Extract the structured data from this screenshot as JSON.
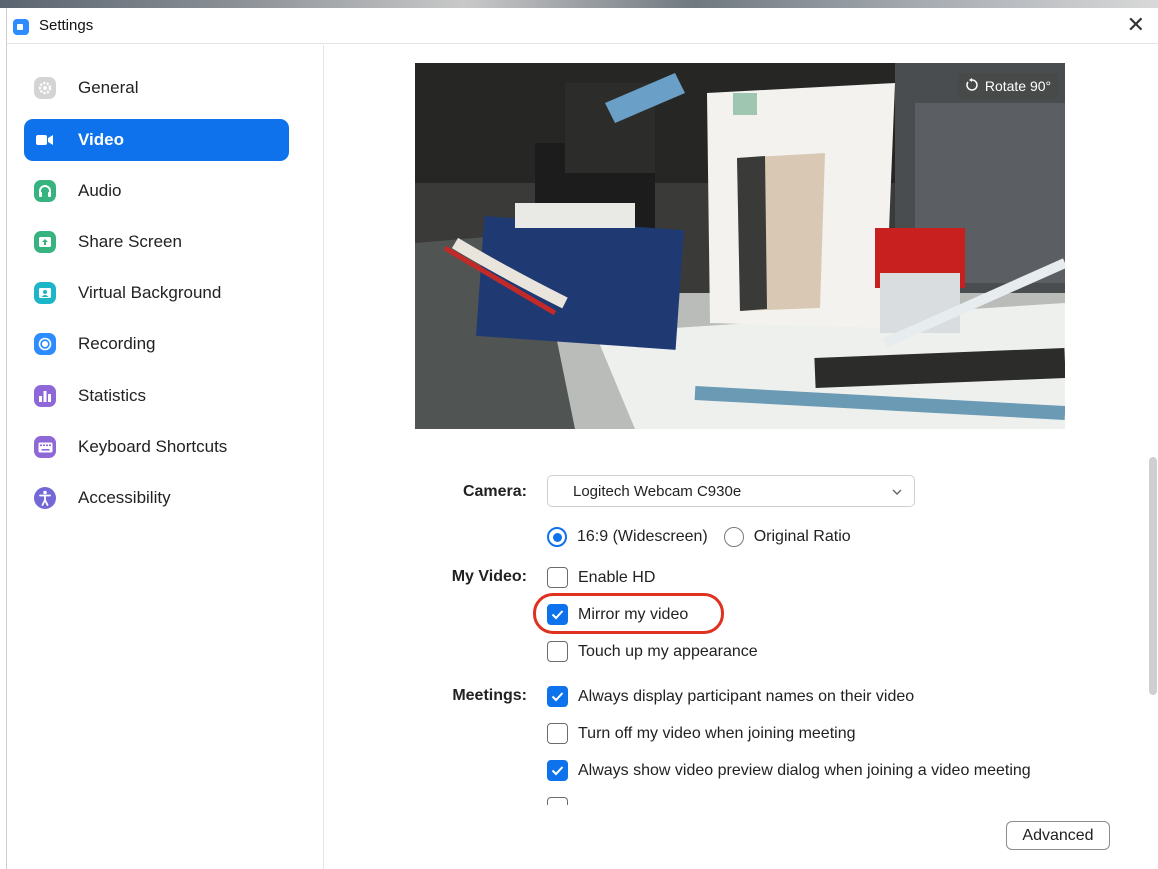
{
  "window": {
    "title": "Settings",
    "close_label": "✕"
  },
  "sidebar": {
    "items": [
      {
        "label": "General",
        "icon": "gear-icon",
        "color": "#c8c8c8",
        "active": false
      },
      {
        "label": "Video",
        "icon": "video-camera-icon",
        "color": "#ffffff",
        "active": true
      },
      {
        "label": "Audio",
        "icon": "headphones-icon",
        "color": "#36b37e",
        "active": false
      },
      {
        "label": "Share Screen",
        "icon": "share-screen-icon",
        "color": "#36b37e",
        "active": false
      },
      {
        "label": "Virtual Background",
        "icon": "virtual-background-icon",
        "color": "#1db5c8",
        "active": false
      },
      {
        "label": "Recording",
        "icon": "recording-icon",
        "color": "#2d8cff",
        "active": false
      },
      {
        "label": "Statistics",
        "icon": "statistics-icon",
        "color": "#8e67d8",
        "active": false
      },
      {
        "label": "Keyboard Shortcuts",
        "icon": "keyboard-icon",
        "color": "#8e67d8",
        "active": false
      },
      {
        "label": "Accessibility",
        "icon": "accessibility-icon",
        "color": "#7468d6",
        "active": false
      }
    ]
  },
  "preview": {
    "rotate_label": "Rotate 90°"
  },
  "camera": {
    "label": "Camera:",
    "selected": "Logitech Webcam C930e"
  },
  "ratio": {
    "widescreen_label": "16:9 (Widescreen)",
    "widescreen_selected": true,
    "original_label": "Original Ratio",
    "original_selected": false
  },
  "my_video": {
    "label": "My Video:",
    "enable_hd": {
      "label": "Enable HD",
      "checked": false
    },
    "mirror": {
      "label": "Mirror my video",
      "checked": true
    },
    "touch_up": {
      "label": "Touch up my appearance",
      "checked": false
    }
  },
  "meetings": {
    "label": "Meetings:",
    "display_names": {
      "label": "Always display participant names on their video",
      "checked": true
    },
    "turn_off_video": {
      "label": "Turn off my video when joining meeting",
      "checked": false
    },
    "show_preview": {
      "label": "Always show video preview dialog when joining a video meeting",
      "checked": true
    }
  },
  "advanced_label": "Advanced",
  "colors": {
    "accent": "#0e72ed",
    "highlight": "#e0301e"
  }
}
